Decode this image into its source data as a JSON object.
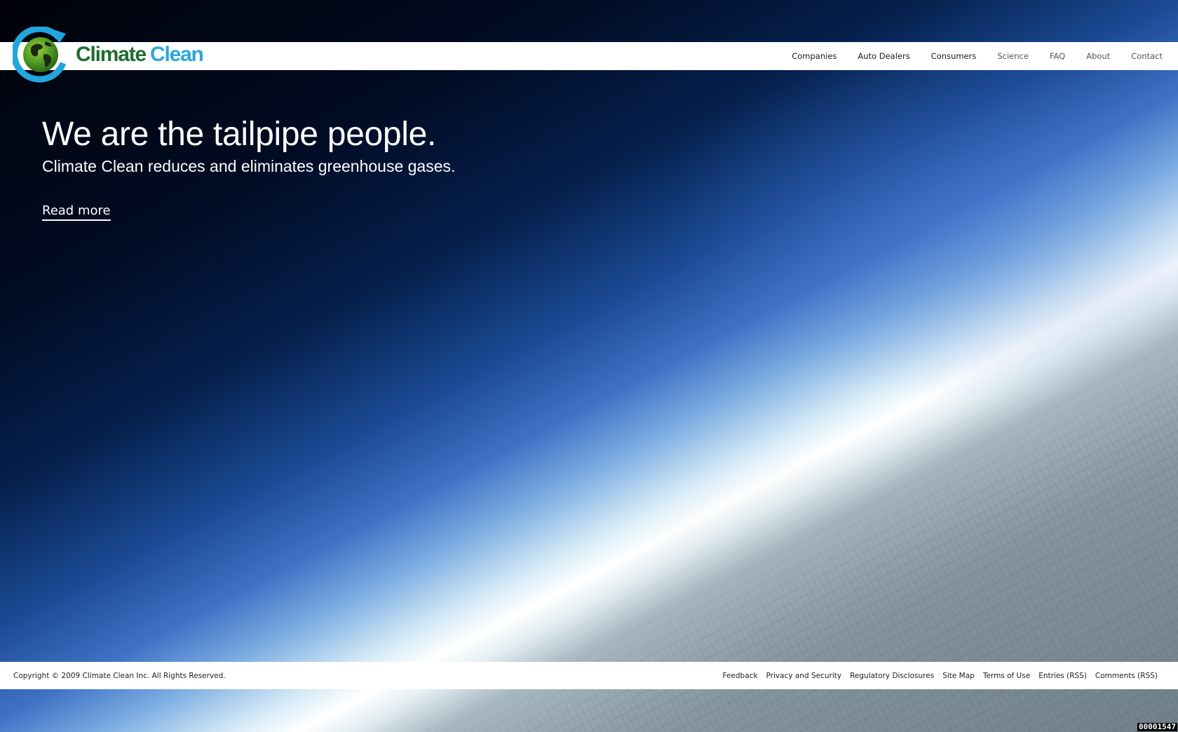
{
  "brand": {
    "name_part1": "Climate",
    "name_part2": "Clean",
    "logo_icon": "globe-arrow-icon",
    "colors": {
      "green": "#1e6e2f",
      "blue": "#2aa8dc"
    }
  },
  "nav": {
    "items": [
      {
        "label": "Companies"
      },
      {
        "label": "Auto Dealers"
      },
      {
        "label": "Consumers"
      },
      {
        "label": "Science"
      },
      {
        "label": "FAQ"
      },
      {
        "label": "About"
      },
      {
        "label": "Contact"
      }
    ]
  },
  "hero": {
    "title": "We are the tailpipe people.",
    "subtitle": "Climate Clean reduces and eliminates greenhouse gases.",
    "link_label": "Read more"
  },
  "footer": {
    "copyright": "Copyright © 2009 Climate Clean Inc. All Rights Reserved.",
    "links": [
      {
        "label": "Feedback"
      },
      {
        "label": "Privacy and Security"
      },
      {
        "label": "Regulatory Disclosures"
      },
      {
        "label": "Site Map"
      },
      {
        "label": "Terms of Use"
      },
      {
        "label": "Entries (RSS)"
      },
      {
        "label": "Comments (RSS)"
      }
    ]
  },
  "counter": "00001547"
}
